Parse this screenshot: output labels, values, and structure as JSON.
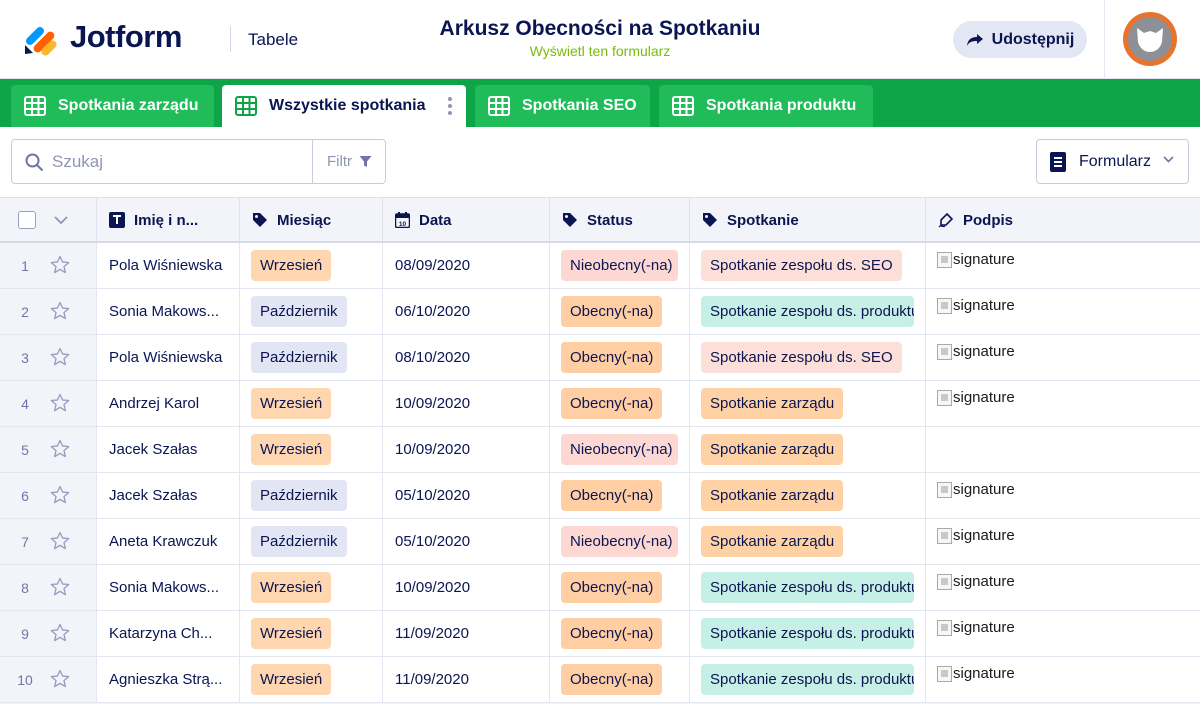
{
  "header": {
    "logo_text": "Jotform",
    "section": "Tabele",
    "title": "Arkusz Obecności na Spotkaniu",
    "subtitle": "Wyświetl ten formularz",
    "share_label": "Udostępnij"
  },
  "tabs": [
    {
      "label": "Spotkania zarządu",
      "active": false
    },
    {
      "label": "Wszystkie spotkania",
      "active": true
    },
    {
      "label": "Spotkania SEO",
      "active": false
    },
    {
      "label": "Spotkania produktu",
      "active": false
    }
  ],
  "toolbar": {
    "search_placeholder": "Szukaj",
    "filter_label": "Filtr",
    "form_label": "Formularz"
  },
  "columns": {
    "name": "Imię i n...",
    "month": "Miesiąc",
    "date": "Data",
    "status": "Status",
    "meeting": "Spotkanie",
    "signature": "Podpis"
  },
  "chip_colors": {
    "month": {
      "Wrzesień": "#fed6b0",
      "Październik": "#e2e5f4"
    },
    "status": {
      "Nieobecny(-na)": "#fdd8d3",
      "Obecny(-na)": "#ffcfa3"
    },
    "meeting": {
      "Spotkanie zespołu ds. SEO": "#fddfd9",
      "Spotkanie zespołu ds. produktu": "#c6f0e6",
      "Spotkanie zarządu": "#ffd2a6"
    }
  },
  "rows": [
    {
      "num": "1",
      "name": "Pola Wiśniewska",
      "month": "Wrzesień",
      "date": "08/09/2020",
      "status": "Nieobecny(-na)",
      "meeting": "Spotkanie zespołu ds. SEO",
      "signature": "signature"
    },
    {
      "num": "2",
      "name": "Sonia Makows...",
      "month": "Październik",
      "date": "06/10/2020",
      "status": "Obecny(-na)",
      "meeting": "Spotkanie zespołu ds. produktu",
      "signature": "signature"
    },
    {
      "num": "3",
      "name": "Pola Wiśniewska",
      "month": "Październik",
      "date": "08/10/2020",
      "status": "Obecny(-na)",
      "meeting": "Spotkanie zespołu ds. SEO",
      "signature": "signature"
    },
    {
      "num": "4",
      "name": "Andrzej Karol",
      "month": "Wrzesień",
      "date": "10/09/2020",
      "status": "Obecny(-na)",
      "meeting": "Spotkanie zarządu",
      "signature": "signature"
    },
    {
      "num": "5",
      "name": "Jacek Szałas",
      "month": "Wrzesień",
      "date": "10/09/2020",
      "status": "Nieobecny(-na)",
      "meeting": "Spotkanie zarządu",
      "signature": ""
    },
    {
      "num": "6",
      "name": "Jacek Szałas",
      "month": "Październik",
      "date": "05/10/2020",
      "status": "Obecny(-na)",
      "meeting": "Spotkanie zarządu",
      "signature": "signature"
    },
    {
      "num": "7",
      "name": "Aneta Krawczuk",
      "month": "Październik",
      "date": "05/10/2020",
      "status": "Nieobecny(-na)",
      "meeting": "Spotkanie zarządu",
      "signature": "signature"
    },
    {
      "num": "8",
      "name": "Sonia Makows...",
      "month": "Wrzesień",
      "date": "10/09/2020",
      "status": "Obecny(-na)",
      "meeting": "Spotkanie zespołu ds. produktu",
      "signature": "signature"
    },
    {
      "num": "9",
      "name": "Katarzyna Ch...",
      "month": "Wrzesień",
      "date": "11/09/2020",
      "status": "Obecny(-na)",
      "meeting": "Spotkanie zespołu ds. produktu",
      "signature": "signature"
    },
    {
      "num": "10",
      "name": "Agnieszka Strą...",
      "month": "Wrzesień",
      "date": "11/09/2020",
      "status": "Obecny(-na)",
      "meeting": "Spotkanie zespołu ds. produktu",
      "signature": "signature"
    }
  ]
}
